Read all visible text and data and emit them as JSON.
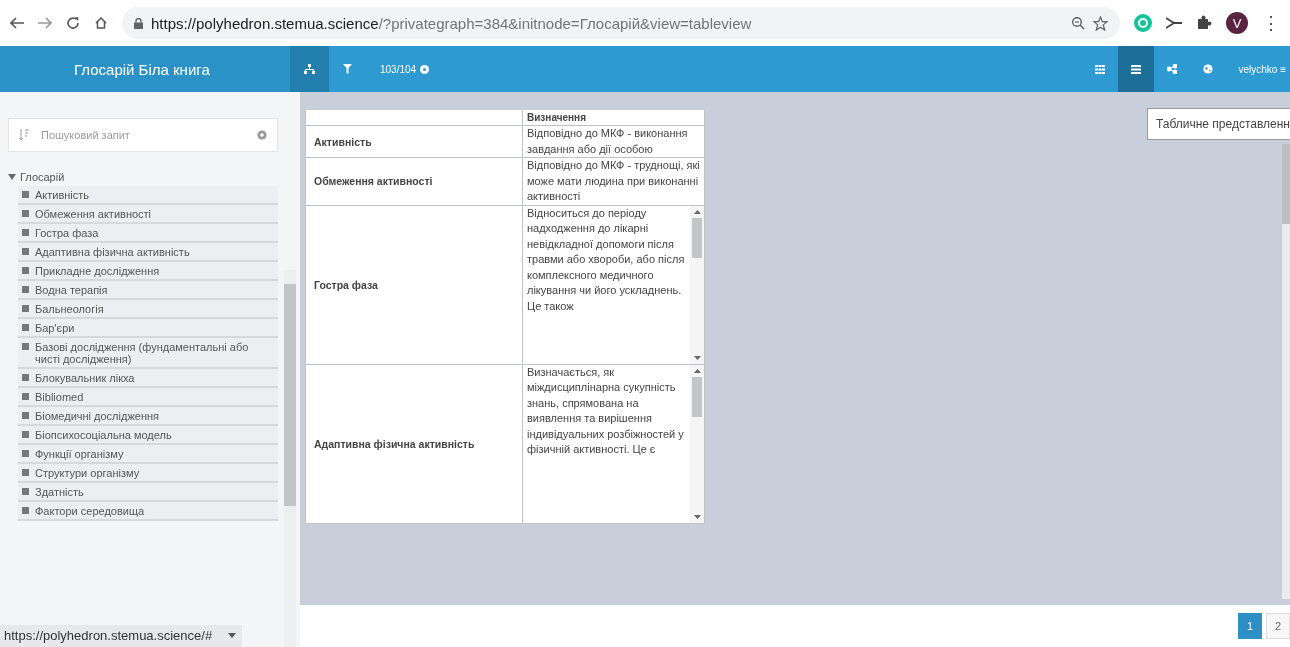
{
  "browser": {
    "url_host": "https://polyhedron.stemua.science",
    "url_rest": "/?privategraph=384&initnode=Глосарій&view=tableview",
    "avatar": "V",
    "menu": "⋮"
  },
  "app_header": {
    "title": "Глосарій Біла книга",
    "counter": "103/104",
    "views": [
      {
        "kind": "grid",
        "selected": false
      },
      {
        "kind": "table",
        "selected": true
      },
      {
        "kind": "share",
        "selected": false
      },
      {
        "kind": "globe",
        "selected": false
      }
    ],
    "user": "velychko ≡"
  },
  "tooltip": "Табличне представленн",
  "sidebar": {
    "search": {
      "placeholder": "Пошуковий запит"
    },
    "tree": [
      {
        "label": "Глосарій",
        "expanded": true,
        "children": [
          {
            "label": "Активність"
          },
          {
            "label": "Обмеження активності"
          },
          {
            "label": "Гостра фаза"
          },
          {
            "label": "Адаптивна фізична активність"
          },
          {
            "label": "Прикладне дослідження"
          },
          {
            "label": "Водна терапія"
          },
          {
            "label": "Бальнеологія"
          },
          {
            "label": "Бар'єри"
          },
          {
            "label": "Базові дослідження (фундаментальні або чисті дослідження)"
          },
          {
            "label": "Блокувальник лікха"
          },
          {
            "label": "Bibliomed"
          },
          {
            "label": "Біомедичні дослідження"
          },
          {
            "label": "Біопсихосоціальна модель"
          },
          {
            "label": "Функції організму"
          },
          {
            "label": "Структури організму"
          },
          {
            "label": "Здатність"
          },
          {
            "label": "Фактори середовища"
          }
        ]
      }
    ]
  },
  "table": {
    "heading": "Визначення",
    "rows": [
      {
        "term": "Активність",
        "definition": "Відповідно до МКФ - виконання завдання або дії особою",
        "scrollable": false
      },
      {
        "term": "Обмеження активності",
        "definition": "Відповідно до МКФ - труднощі, які може мати людина при виконанні активності",
        "scrollable": false
      },
      {
        "term": "Гостра фаза",
        "definition": "Відноситься до періоду надходження до лікарні невідкладної допомоги після травми або хвороби, або після комплексного медичного лікування чи його ускладнень. Це також",
        "scrollable": true
      },
      {
        "term": "Адаптивна фізична активність",
        "definition": "Визначається, як міждисциплінарна сукупність знань, спрямована на виявлення та вирішення індивідуальних розбіжностей у фізичній активності. Це є",
        "scrollable": true
      }
    ]
  },
  "pagination": [
    {
      "label": "1",
      "selected": true
    },
    {
      "label": "2",
      "selected": false
    }
  ],
  "status_bar": {
    "url": "https://polyhedron.stemua.science/#"
  }
}
